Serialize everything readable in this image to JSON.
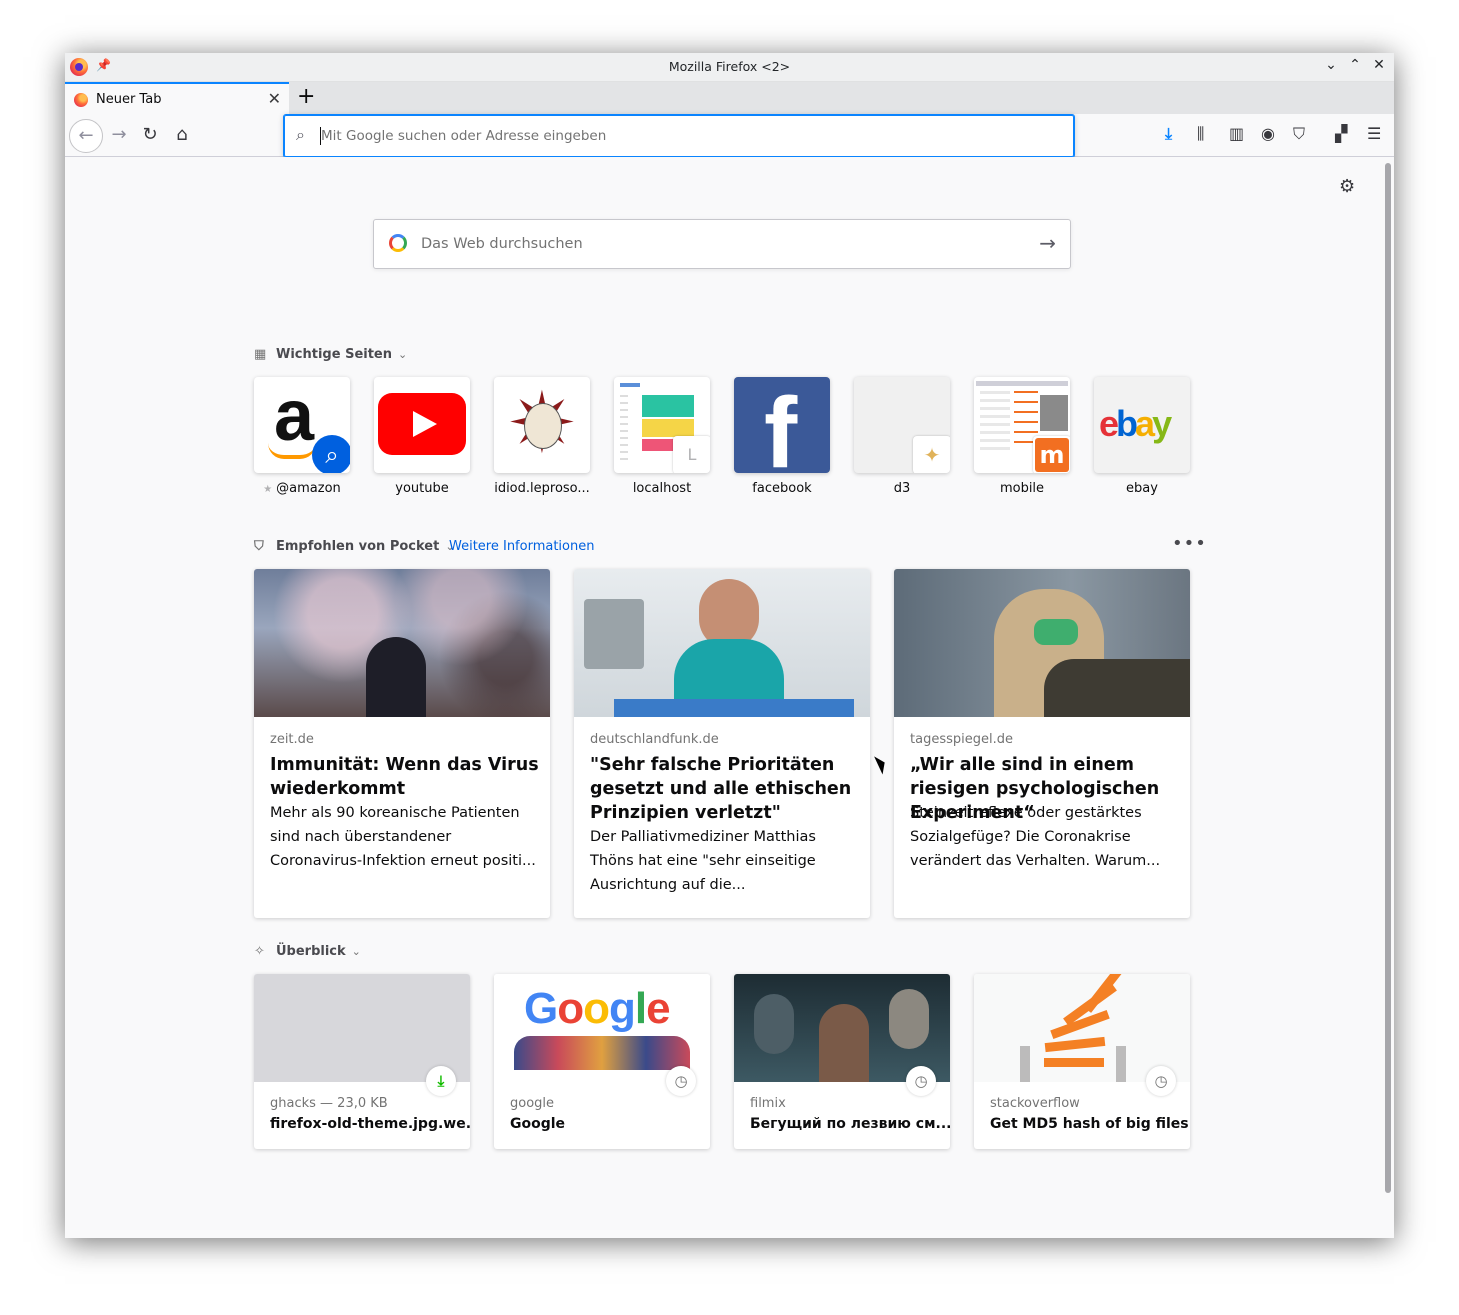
{
  "window": {
    "title": "Mozilla Firefox <2>"
  },
  "tabs": [
    {
      "label": "Neuer Tab"
    }
  ],
  "urlbar": {
    "placeholder": "Mit Google suchen oder Adresse eingeben"
  },
  "websearch": {
    "placeholder": "Das Web durchsuchen"
  },
  "top_sites": {
    "heading": "Wichtige Seiten",
    "items": [
      {
        "label": "@amazon"
      },
      {
        "label": "youtube"
      },
      {
        "label": "idiod.leproso..."
      },
      {
        "label": "localhost",
        "badge": "L"
      },
      {
        "label": "facebook"
      },
      {
        "label": "d3"
      },
      {
        "label": "mobile"
      },
      {
        "label": "ebay"
      }
    ]
  },
  "pocket": {
    "heading": "Empfohlen von Pocket",
    "link": "Weitere Informationen",
    "stories": [
      {
        "source": "zeit.de",
        "title": "Immunität: Wenn das Virus wiederkommt",
        "excerpt": "Mehr als 90 koreanische Patienten sind nach überstandener Coronavirus-Infektion erneut positi..."
      },
      {
        "source": "deutschlandfunk.de",
        "title": "\"Sehr falsche Prioritäten gesetzt und alle ethischen Prinzipien verletzt\"",
        "excerpt": "Der Palliativmediziner Matthias Thöns hat eine \"sehr einseitige Ausrichtung auf die..."
      },
      {
        "source": "tagesspiegel.de",
        "title": "„Wir alle sind in einem riesigen psychologischen Experiment“",
        "excerpt": "Steinzeitreflexe oder gestärktes Sozialgefüge? Die Coronakrise verändert das Verhalten. Warum..."
      }
    ]
  },
  "highlights": {
    "heading": "Überblick",
    "items": [
      {
        "source": "ghacks — 23,0 KB",
        "title": "firefox-old-theme.jpg.we...",
        "badge": "download-icon"
      },
      {
        "source": "google",
        "title": "Google",
        "badge": "clock-icon"
      },
      {
        "source": "filmix",
        "title": "Бегущий по лезвию см...",
        "badge": "clock-icon"
      },
      {
        "source": "stackoverflow",
        "title": "Get MD5 hash of big files...",
        "badge": "clock-icon"
      }
    ]
  },
  "logos": {
    "amazon": "a",
    "facebook": "f",
    "ebay": [
      "e",
      "b",
      "a",
      "y"
    ],
    "google_doodle": [
      "G",
      "o",
      "o",
      "g",
      "l",
      "e"
    ],
    "mobile_badge": "m"
  },
  "colors": {
    "accent": "#0a84ff",
    "link": "#0060df",
    "youtube": "#ff0000",
    "facebook": "#3b5998",
    "stackoverflow": "#f48024",
    "download_green": "#12bc00"
  }
}
